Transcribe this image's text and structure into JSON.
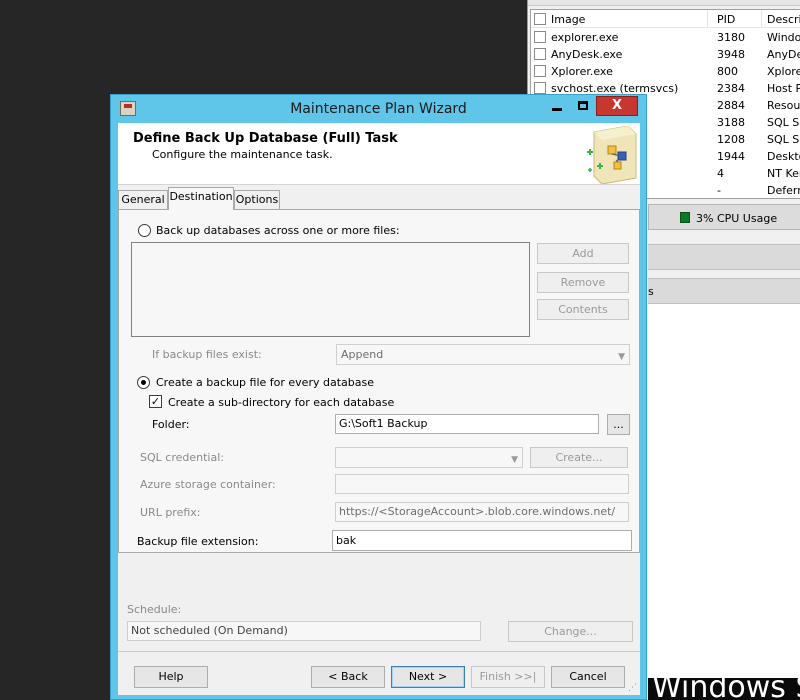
{
  "task_manager": {
    "columns": {
      "image": "Image",
      "pid": "PID",
      "description": "Descrip"
    },
    "processes": [
      {
        "image": "explorer.exe",
        "pid": "3180",
        "description": "Windo..."
      },
      {
        "image": "AnyDesk.exe",
        "pid": "3948",
        "description": "AnyDes"
      },
      {
        "image": "Xplorer.exe",
        "pid": "800",
        "description": "Xplorer"
      },
      {
        "image": "svchost.exe (termsvcs)",
        "pid": "2384",
        "description": "Host Pr"
      },
      {
        "image": "",
        "pid": "2884",
        "description": "Resour"
      },
      {
        "image": "",
        "pid": "3188",
        "description": "SQL Ser"
      },
      {
        "image": "",
        "pid": "1208",
        "description": "SQL Ser"
      },
      {
        "image": "",
        "pid": "1944",
        "description": "Deskto"
      },
      {
        "image": "",
        "pid": "4",
        "description": "NT Ker..."
      },
      {
        "image": "",
        "pid": "-",
        "description": "Deferre"
      }
    ],
    "cpu_usage": "3% CPU Usage",
    "band_text": "s",
    "windows_text": "Windows S"
  },
  "dialog": {
    "title": "Maintenance Plan Wizard",
    "caption_close": "X",
    "header_title": "Define Back Up Database (Full) Task",
    "header_subtitle": "Configure the maintenance task.",
    "tabs": [
      "General",
      "Destination",
      "Options"
    ],
    "active_tab": "Destination",
    "destination": {
      "backup_across_files_label": "Back up databases across one or more files:",
      "add_button": "Add",
      "remove_button": "Remove",
      "contents_button": "Contents",
      "if_exists_label": "If backup files exist:",
      "if_exists_value": "Append",
      "create_per_db_label": "Create a backup file for every database",
      "create_subdir_label": "Create a sub-directory for each database",
      "folder_label": "Folder:",
      "folder_value": "G:\\Soft1 Backup",
      "browse_button": "...",
      "sql_credential_label": "SQL credential:",
      "sql_credential_value": "",
      "create_button": "Create...",
      "azure_container_label": "Azure storage container:",
      "azure_container_value": "",
      "url_prefix_label": "URL prefix:",
      "url_prefix_value": "https://<StorageAccount>.blob.core.windows.net/",
      "extension_label": "Backup file extension:",
      "extension_value": "bak"
    },
    "schedule": {
      "label": "Schedule:",
      "value": "Not scheduled (On Demand)",
      "change_button": "Change..."
    },
    "footer": {
      "help": "Help",
      "back": "< Back",
      "next": "Next >",
      "finish": "Finish >>|",
      "cancel": "Cancel"
    }
  }
}
